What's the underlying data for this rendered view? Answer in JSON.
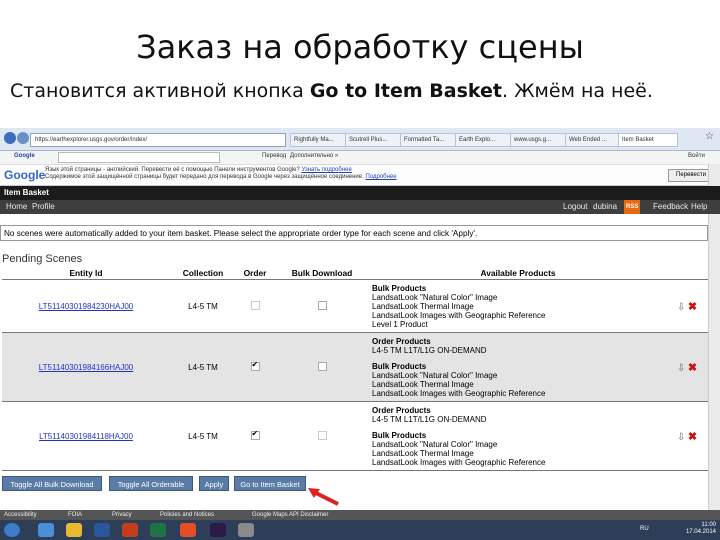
{
  "slide": {
    "title": "Заказ на обработку сцены",
    "subtitle_before": "Становится активной кнопка ",
    "subtitle_bold": "Go to Item Basket",
    "subtitle_after": ". Жмём на неё."
  },
  "browser": {
    "address": "https://earthexplorer.usgs.gov/order/index/",
    "tabs": [
      "Rightfully Ma...",
      "Scutrell Plus...",
      "Formatted Ta...",
      "Earth Explo...",
      "www.usgs.g...",
      "Web Ended ...",
      "Item Basket"
    ],
    "toolbar_label": "Google",
    "translate_label": "Перевод",
    "more_label": "Дополнительно »",
    "sign_in": "Войти"
  },
  "google_bar": {
    "logo": "Google",
    "line1_prefix": "Язык этой страницы - английский. Перевести её с помощью Панели инструментов Google? ",
    "line1_link": "Узнать подробнее",
    "line2": "Содержимое этой защищённой страницы будет передано для перевода в Google через защищённое соединение.",
    "line2_link": "Подробнее",
    "translate_button": "Перевести"
  },
  "page": {
    "header": "Item Basket",
    "nav": {
      "home": "Home",
      "profile": "Profile",
      "logout": "Logout",
      "user": "dubina",
      "rss": "RSS",
      "feedback": "Feedback",
      "help": "Help"
    },
    "notice": "No scenes were automatically added to your item basket. Please select the appropriate order type for each scene and click 'Apply'.",
    "pending_title": "Pending Scenes",
    "columns": [
      "Entity Id",
      "Collection",
      "Order",
      "Bulk Download",
      "Available Products"
    ],
    "rows": [
      {
        "entity": "LT51140301984230HAJ00",
        "collection": "L4-5 TM",
        "order_checked": false,
        "bulk_checked": false,
        "products": [
          "Bulk Products",
          "LandsatLook \"Natural Color\" Image",
          "LandsatLook Thermal Image",
          "LandsatLook Images with Geographic Reference",
          "Level 1 Product"
        ]
      },
      {
        "entity": "LT51140301984166HAJ00",
        "collection": "L4-5 TM",
        "order_checked": true,
        "bulk_checked": false,
        "products": [
          "Order Products",
          "L4-5 TM L1T/L1G ON-DEMAND",
          "",
          "Bulk Products",
          "LandsatLook \"Natural Color\" Image",
          "LandsatLook Thermal Image",
          "LandsatLook Images with Geographic Reference"
        ]
      },
      {
        "entity": "LT51140301984118HAJ00",
        "collection": "L4-5 TM",
        "order_checked": true,
        "bulk_checked": false,
        "products": [
          "Order Products",
          "L4-5 TM L1T/L1G ON-DEMAND",
          "",
          "Bulk Products",
          "LandsatLook \"Natural Color\" Image",
          "LandsatLook Thermal Image",
          "LandsatLook Images with Geographic Reference"
        ]
      }
    ],
    "buttons": {
      "toggle_bulk": "Toggle All Bulk Download",
      "toggle_orderable": "Toggle All Orderable",
      "apply": "Apply",
      "go_basket": "Go to Item Basket"
    },
    "footer": [
      "Accessibility",
      "FOIA",
      "Privacy",
      "Policies and Notices",
      "Google Maps API Disclaimer"
    ]
  },
  "taskbar": {
    "lang": "RU",
    "time": "11:00",
    "date": "17.04.2014"
  },
  "colors": {
    "accent_button": "#5a7ca6",
    "delete_icon": "#d01010",
    "arrow": "#e02020"
  }
}
